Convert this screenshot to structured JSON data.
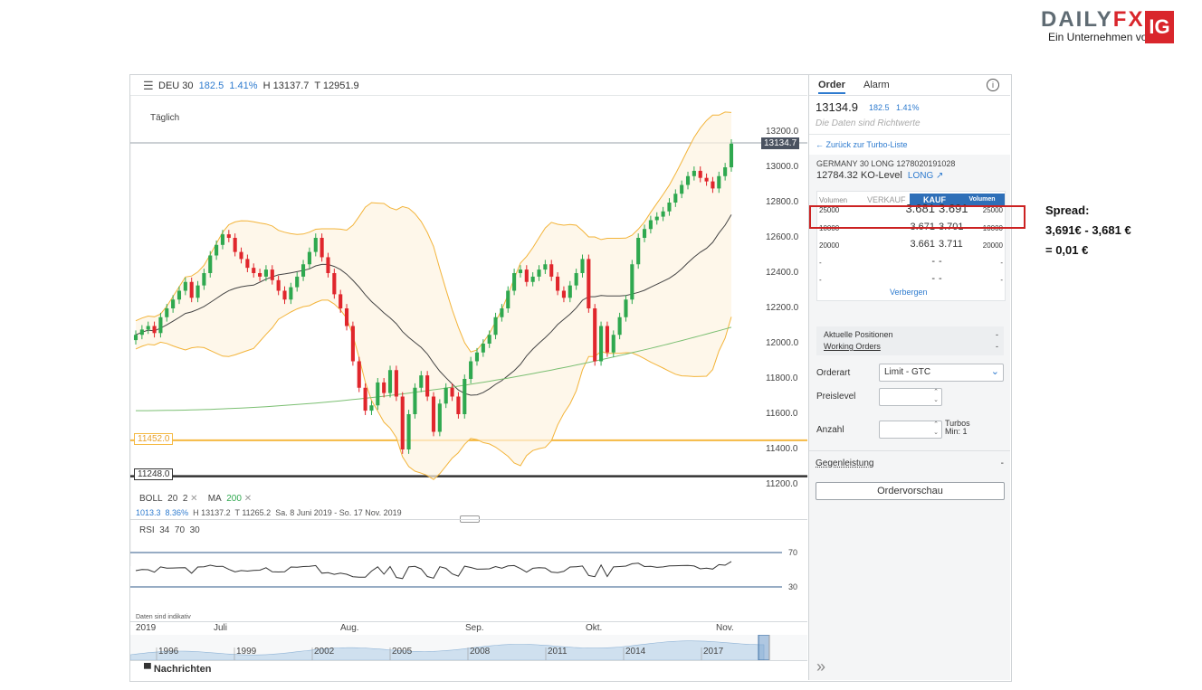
{
  "logo": {
    "word_a": "DAILY",
    "word_b": "FX",
    "badge": "IG",
    "tagline": "Ein Unternehmen von"
  },
  "header": {
    "symbol": "DEU 30",
    "change": "182.5",
    "change_pct": "1.41%",
    "high": "H 13137.7",
    "low": "T 12951.9"
  },
  "chart": {
    "timeframe": "Täglich",
    "current_price_tag": "13134.7",
    "hline_upper": "11452.0",
    "hline_lower": "11248.0",
    "y_ticks": [
      "13200.0",
      "13000.0",
      "12800.0",
      "12600.0",
      "12400.0",
      "12200.0",
      "12000.0",
      "11800.0",
      "11600.0",
      "11400.0",
      "11200.0"
    ],
    "indicators_label": {
      "boll": "BOLL",
      "boll_p1": "20",
      "boll_p2": "2",
      "ma": "MA",
      "ma_p": "200",
      "remove": "✕"
    },
    "stats": {
      "range": "1013.3",
      "pct": "8.36%",
      "high": "H 13137.2",
      "low": "T 11265.2",
      "period": "Sa. 8 Juni 2019 - So. 17 Nov. 2019"
    },
    "rsi_label": {
      "name": "RSI",
      "p1": "34",
      "p2": "70",
      "p3": "30"
    },
    "rsi_ticks": [
      "70",
      "30"
    ],
    "disclaimer": "Daten sind indikativ",
    "x_year": "2019",
    "x_months": [
      "Juli",
      "Aug.",
      "Sep.",
      "Okt.",
      "Nov."
    ],
    "nav_years": [
      "1996",
      "1999",
      "2002",
      "2005",
      "2008",
      "2011",
      "2014",
      "2017"
    ],
    "news_label": "Nachrichten",
    "colors": {
      "up": "#2fa84f",
      "down": "#e0262c",
      "boll": "#f3b43a",
      "ma20": "#444444",
      "ma200": "#7bbf72",
      "hline_upper": "#f5b942",
      "hline_lower": "#333333"
    }
  },
  "chart_data": {
    "type": "candlestick",
    "title": "DEU 30",
    "ylim": [
      11150,
      13300
    ],
    "period": "Sa. 8 Juni 2019 - So. 17 Nov. 2019",
    "candles_close": [
      12050,
      12080,
      12100,
      12060,
      12150,
      12200,
      12250,
      12300,
      12350,
      12260,
      12330,
      12400,
      12500,
      12560,
      12620,
      12600,
      12520,
      12480,
      12430,
      12400,
      12380,
      12420,
      12360,
      12300,
      12250,
      12320,
      12380,
      12450,
      12520,
      12600,
      12490,
      12400,
      12280,
      12200,
      12100,
      11900,
      11750,
      11620,
      11650,
      11780,
      11720,
      11850,
      11700,
      11400,
      11600,
      11750,
      11820,
      11700,
      11500,
      11660,
      11750,
      11700,
      11600,
      11800,
      11900,
      11950,
      12000,
      12050,
      12150,
      12200,
      12300,
      12400,
      12420,
      12350,
      12380,
      12420,
      12450,
      12380,
      12300,
      12260,
      12330,
      12400,
      12480,
      12200,
      11900,
      12100,
      11950,
      12050,
      12150,
      12250,
      12450,
      12600,
      12650,
      12700,
      12720,
      12750,
      12800,
      12850,
      12900,
      12950,
      12980,
      12940,
      12920,
      12880,
      12950,
      13000,
      13134
    ]
  },
  "side": {
    "tab_order": "Order",
    "tab_alarm": "Alarm",
    "info": "i",
    "price": "13134.9",
    "change": "182.5",
    "change_pct": "1.41%",
    "note": "Die Daten sind Richtwerte",
    "back_link": "← Zurück zur Turbo-Liste",
    "product": "GERMANY 30 LONG 1278020191028",
    "ko_level": "12784.32 KO-Level",
    "direction": "LONG ↗",
    "quote_head": {
      "vol_left": "Volumen",
      "sell": "VERKAUF",
      "buy": "KAUF",
      "vol_right": "Volumen"
    },
    "quotes": [
      {
        "vol_l": "25000",
        "bid": "3.681",
        "ask": "3.691",
        "vol_r": "25000"
      },
      {
        "vol_l": "10000",
        "bid": "3.671",
        "ask": "3.701",
        "vol_r": "10000"
      },
      {
        "vol_l": "20000",
        "bid": "3.661",
        "ask": "3.711",
        "vol_r": "20000"
      },
      {
        "vol_l": "-",
        "bid": "-",
        "ask": "-",
        "vol_r": "-"
      },
      {
        "vol_l": "-",
        "bid": "-",
        "ask": "-",
        "vol_r": "-"
      }
    ],
    "hide": "Verbergen",
    "positions": "Aktuelle Positionen",
    "positions_val": "-",
    "working_orders": "Working Orders",
    "working_val": "-",
    "order_type_label": "Orderart",
    "order_type_value": "Limit - GTC",
    "price_level_label": "Preislevel",
    "qty_label": "Anzahl",
    "qty_unit": "Turbos",
    "qty_min": "Min: 1",
    "counter_label": "Gegenleistung",
    "counter_val": "-",
    "preview_button": "Ordervorschau",
    "collapse": "»"
  },
  "annotation": {
    "line1": "Spread:",
    "line2": "3,691€ - 3,681 €",
    "line3": "= 0,01 €"
  }
}
